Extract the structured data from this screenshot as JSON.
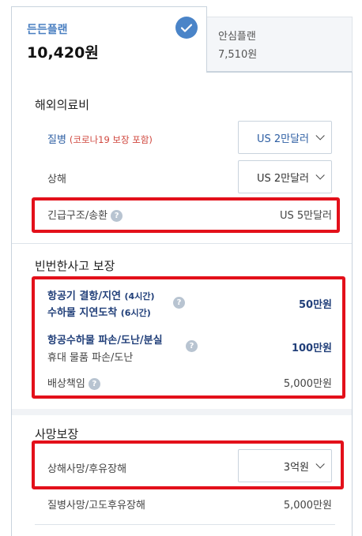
{
  "plans": [
    {
      "name": "든든플랜",
      "price": "10,420원",
      "selected": true
    },
    {
      "name": "안심플랜",
      "price": "7,510원",
      "selected": false
    }
  ],
  "sections": {
    "overseas_medical": {
      "title": "해외의료비",
      "illness_label": "질병",
      "illness_note": "(코로나19 보장 포함)",
      "illness_value": "US 2만달러",
      "injury_label": "상해",
      "injury_value": "US 2만달러",
      "rescue_label": "긴급구조/송환",
      "rescue_value": "US 5만달러"
    },
    "frequent_accident": {
      "title": "빈번한사고 보장",
      "delay_label": "항공기 결항/지연",
      "delay_note": "(4시간)",
      "cargo_label": "수하물 지연도착",
      "cargo_note": "(6시간)",
      "delay_value": "50만원",
      "baggage_label": "항공수하물 파손/도난/분실",
      "belongings_label": "휴대 물품 파손/도난",
      "baggage_value": "100만원",
      "liability_label": "배상책임",
      "liability_value": "5,000만원"
    },
    "death": {
      "title": "사망보장",
      "injury_death_label": "상해사망/후유장해",
      "injury_death_value": "3억원",
      "illness_death_label": "질병사망/고도후유장해",
      "illness_death_value": "5,000만원"
    }
  },
  "help_symbol": "?",
  "colors": {
    "accent": "#4a84c8",
    "highlight": "#e3101a",
    "label_blue": "#2e5fa3",
    "note_red": "#d0473e"
  }
}
